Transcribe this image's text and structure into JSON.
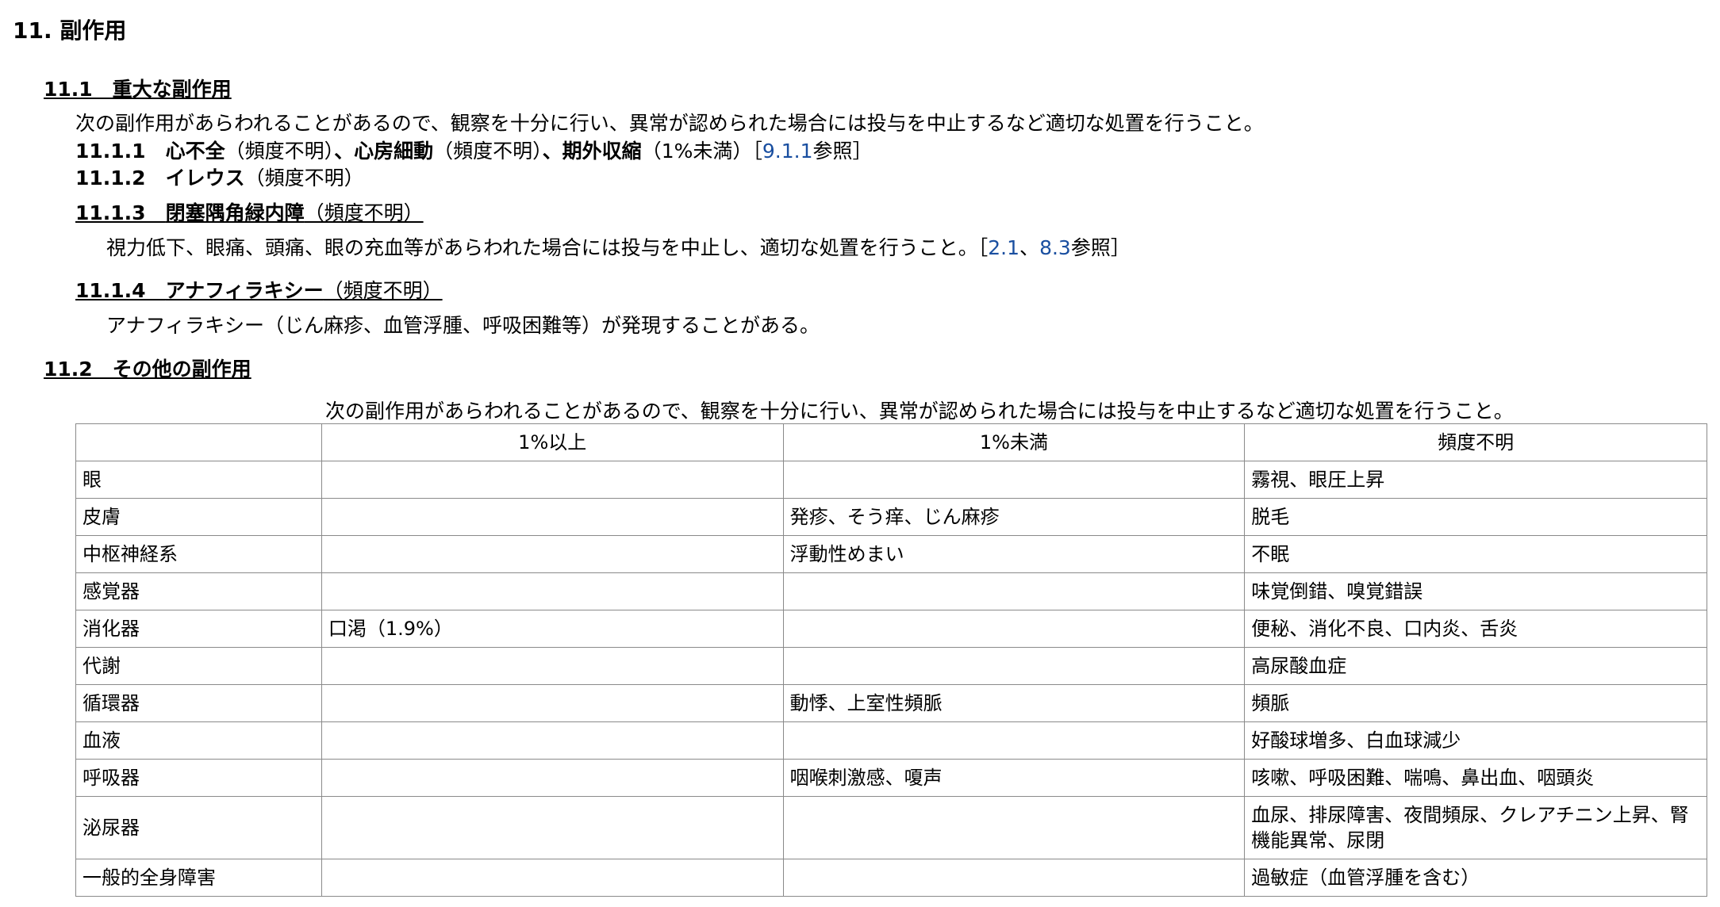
{
  "section": {
    "title": "11. 副作用"
  },
  "serious": {
    "heading": "11.1　重大な副作用",
    "intro": "次の副作用があらわれることがあるので、観察を十分に行い、異常が認められた場合には投与を中止するなど適切な処置を行うこと。",
    "item1": {
      "number": "11.1.1　",
      "t1": "心不全",
      "f1": "（頻度不明）",
      "sep1": "、",
      "t2": "心房細動",
      "f2": "（頻度不明）",
      "sep2": "、",
      "t3": "期外収縮",
      "f3": "（1%未満）",
      "ref_open": "［",
      "ref1": "9.1.1",
      "ref_suffix": "参照",
      "ref_close": "］"
    },
    "item2": {
      "number": "11.1.2　",
      "term": "イレウス",
      "freq": "（頻度不明）"
    },
    "item3": {
      "number": "11.1.3　",
      "term": "閉塞隅角緑内障",
      "freq": "（頻度不明）",
      "desc": "視力低下、眼痛、頭痛、眼の充血等があらわれた場合には投与を中止し、適切な処置を行うこと。",
      "ref_open": "［",
      "ref1": "2.1",
      "ref_sep": "、",
      "ref2": "8.3",
      "ref_suffix": "参照",
      "ref_close": "］"
    },
    "item4": {
      "number": "11.1.4　",
      "term": "アナフィラキシー",
      "freq": "（頻度不明）",
      "desc": "アナフィラキシー（じん麻疹、血管浮腫、呼吸困難等）が発現することがある。"
    }
  },
  "other": {
    "heading": "11.2　その他の副作用",
    "caption": "次の副作用があらわれることがあるので、観察を十分に行い、異常が認められた場合には投与を中止するなど適切な処置を行うこと。",
    "headers": [
      "",
      "1%以上",
      "1%未満",
      "頻度不明"
    ],
    "rows": [
      [
        "眼",
        "",
        "",
        "霧視、眼圧上昇"
      ],
      [
        "皮膚",
        "",
        "発疹、そう痒、じん麻疹",
        "脱毛"
      ],
      [
        "中枢神経系",
        "",
        "浮動性めまい",
        "不眠"
      ],
      [
        "感覚器",
        "",
        "",
        "味覚倒錯、嗅覚錯誤"
      ],
      [
        "消化器",
        "口渇（1.9%）",
        "",
        "便秘、消化不良、口内炎、舌炎"
      ],
      [
        "代謝",
        "",
        "",
        "高尿酸血症"
      ],
      [
        "循環器",
        "",
        "動悸、上室性頻脈",
        "頻脈"
      ],
      [
        "血液",
        "",
        "",
        "好酸球増多、白血球減少"
      ],
      [
        "呼吸器",
        "",
        "咽喉刺激感、嗄声",
        "咳嗽、呼吸困難、喘鳴、鼻出血、咽頭炎"
      ],
      [
        "泌尿器",
        "",
        "",
        "血尿、排尿障害、夜間頻尿、クレアチニン上昇、腎機能異常、尿閉"
      ],
      [
        "一般的全身障害",
        "",
        "",
        "過敏症（血管浮腫を含む）"
      ]
    ]
  },
  "colors": {
    "link": "#1a4fa0",
    "border": "#8a8a8a"
  }
}
